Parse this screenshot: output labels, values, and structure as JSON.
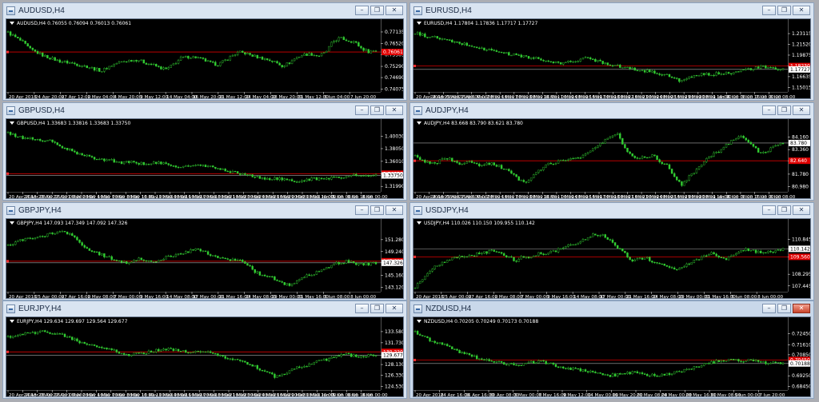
{
  "colors": {
    "candle": "#32cd32",
    "red_line": "#d70000",
    "ask_line": "#aaaaaa",
    "chart_bg": "#000000",
    "axis": "#ffffff"
  },
  "icons": {
    "window": "chart-window-icon",
    "minimize": "minimize-icon",
    "restore": "restore-icon",
    "close": "close-icon",
    "dropdown": "triangle-down-icon"
  },
  "window_buttons": {
    "minimize": "–",
    "restore": "❐",
    "close": "✕"
  },
  "windows": [
    {
      "title": "AUDUSD,H4",
      "header": "AUDUSD,H4  0.76055 0.76094 0.76013 0.76061",
      "price_labels": [
        "0.77135",
        "0.76520",
        "0.75905",
        "0.75290",
        "0.74690",
        "0.74075"
      ],
      "tags": [
        {
          "value": "0.76061",
          "style": "red"
        }
      ],
      "time_labels": [
        "20 Apr 2018",
        "24 Apr 20:00",
        "27 Apr 12:00",
        "2 May 04:00",
        "4 May 20:00",
        "9 May 12:00",
        "14 May 04:00",
        "16 May 20:00",
        "21 May 12:00",
        "24 May 04:00",
        "28 May 20:00",
        "31 May 12:00",
        "5 Jun 04:00",
        "7 Jun 20:00"
      ],
      "series": [
        0.771,
        0.7685,
        0.766,
        0.7622,
        0.7603,
        0.7585,
        0.7572,
        0.7558,
        0.7552,
        0.7545,
        0.7535,
        0.7528,
        0.7515,
        0.7505,
        0.7528,
        0.7545,
        0.7555,
        0.7562,
        0.7565,
        0.7548,
        0.7538,
        0.7522,
        0.7512,
        0.7542,
        0.7575,
        0.758,
        0.7578,
        0.7565,
        0.7548,
        0.7538,
        0.7558,
        0.7585,
        0.7605,
        0.7598,
        0.7585,
        0.7575,
        0.7565,
        0.7552,
        0.7532,
        0.7548,
        0.7578,
        0.7592,
        0.7595,
        0.7585,
        0.7602,
        0.766,
        0.7682,
        0.7668,
        0.7662,
        0.7625,
        0.7608,
        0.7615
      ],
      "min": 0.7405,
      "max": 0.7722,
      "red_level": 0.7606,
      "ask_level": null
    },
    {
      "title": "EURUSD,H4",
      "header": "EURUSD,H4  1.17804 1.17836 1.17717 1.17727",
      "price_labels": [
        "1.23115",
        "1.21520",
        "1.19875",
        "1.18230",
        "1.16635",
        "1.15015"
      ],
      "tags": [
        {
          "value": "1.18230",
          "style": "red"
        },
        {
          "value": "1.17727",
          "style": "white"
        }
      ],
      "time_labels": [
        "20 Apr 2018",
        "24 Apr 08:00",
        "25 Apr 16:00",
        "27 Apr 00:00",
        "1 May 08:00",
        "2 May 16:00",
        "4 May 00:00",
        "7 May 08:00",
        "8 May 16:00",
        "10 May 00:00",
        "11 May 08:00",
        "14 May 16:00",
        "16 May 00:00",
        "17 May 08:00",
        "18 May 16:00",
        "22 May 00:00",
        "23 May 08:00",
        "24 May 16:00",
        "28 May 00:00",
        "29 May 08:00",
        "30 May 16:00",
        "1 Jun 00:00",
        "4 Jun 08:00",
        "5 Jun 16:00",
        "7 Jun 00:00",
        "8 Jun 08:00"
      ],
      "series": [
        1.232,
        1.229,
        1.226,
        1.225,
        1.222,
        1.219,
        1.217,
        1.215,
        1.212,
        1.209,
        1.207,
        1.205,
        1.203,
        1.2,
        1.199,
        1.197,
        1.195,
        1.193,
        1.19,
        1.188,
        1.186,
        1.188,
        1.19,
        1.192,
        1.195,
        1.191,
        1.188,
        1.185,
        1.183,
        1.18,
        1.178,
        1.176,
        1.175,
        1.173,
        1.171,
        1.168,
        1.163,
        1.16,
        1.164,
        1.168,
        1.17,
        1.169,
        1.171,
        1.173,
        1.172,
        1.175,
        1.177,
        1.179,
        1.181,
        1.179,
        1.178,
        1.1773
      ],
      "min": 1.147,
      "max": 1.236,
      "red_level": 1.1825,
      "ask_level": 1.1773
    },
    {
      "title": "GBPUSD,H4",
      "header": "GBPUSD,H4  1.33683 1.33816 1.33683 1.33750",
      "price_labels": [
        "1.40030",
        "1.38050",
        "1.36010",
        "1.34030",
        "1.31990"
      ],
      "tags": [
        {
          "value": "1.34030",
          "style": "red"
        },
        {
          "value": "1.33750",
          "style": "white"
        }
      ],
      "time_labels": [
        "20 Apr 2018",
        "24 Apr 08:00",
        "25 Apr 16:00",
        "27 Apr 00:00",
        "1 May 08:00",
        "2 May 16:00",
        "4 May 00:00",
        "7 May 08:00",
        "8 May 16:00",
        "10 May 00:00",
        "11 May 08:00",
        "14 May 16:00",
        "16 May 00:00",
        "17 May 08:00",
        "18 May 16:00",
        "21 May 00:00",
        "23 May 08:00",
        "24 May 16:00",
        "28 May 00:00",
        "29 May 08:00",
        "31 May 16:00",
        "1 Jun 00:00",
        "5 Jun 08:00",
        "6 Jun 16:00",
        "8 Jun 00:00"
      ],
      "series": [
        1.405,
        1.401,
        1.398,
        1.397,
        1.395,
        1.394,
        1.392,
        1.386,
        1.38,
        1.376,
        1.371,
        1.368,
        1.365,
        1.364,
        1.362,
        1.36,
        1.358,
        1.359,
        1.357,
        1.356,
        1.358,
        1.357,
        1.355,
        1.353,
        1.351,
        1.352,
        1.354,
        1.353,
        1.351,
        1.349,
        1.346,
        1.343,
        1.341,
        1.339,
        1.336,
        1.333,
        1.332,
        1.333,
        1.331,
        1.329,
        1.327,
        1.33,
        1.332,
        1.331,
        1.333,
        1.334,
        1.335,
        1.336,
        1.338,
        1.336,
        1.337,
        1.3375
      ],
      "min": 1.315,
      "max": 1.41,
      "red_level": 1.3403,
      "ask_level": 1.3375
    },
    {
      "title": "AUDJPY,H4",
      "header": "AUDJPY,H4  83.668 83.790 83.621 83.780",
      "price_labels": [
        "84.160",
        "83.780",
        "83.360",
        "82.640",
        "81.780",
        "80.980"
      ],
      "tags": [
        {
          "value": "83.780",
          "style": "white"
        },
        {
          "value": "82.640",
          "style": "red"
        }
      ],
      "time_labels": [
        "20 Apr 2018",
        "24 Apr 08:00",
        "25 Apr 16:00",
        "27 Apr 00:00",
        "1 May 08:00",
        "2 May 16:00",
        "4 May 00:00",
        "7 May 08:00",
        "8 May 16:00",
        "10 May 00:00",
        "11 May 08:00",
        "14 May 16:00",
        "16 May 00:00",
        "17 May 08:00",
        "18 May 16:00",
        "21 May 00:00",
        "23 May 08:00",
        "24 May 16:00",
        "28 May 00:00",
        "29 May 08:00",
        "30 May 16:00",
        "1 Jun 00:00",
        "4 Jun 08:00",
        "5 Jun 16:00",
        "7 Jun 00:00",
        "8 Jun 08:00"
      ],
      "series": [
        82.9,
        82.6,
        82.55,
        82.5,
        82.8,
        82.7,
        82.4,
        82.5,
        82.6,
        82.35,
        82.5,
        82.4,
        82.2,
        82.0,
        81.6,
        81.2,
        81.5,
        81.9,
        82.4,
        82.5,
        82.6,
        82.7,
        82.8,
        82.9,
        83.2,
        83.5,
        83.8,
        84.2,
        84.4,
        83.5,
        83.0,
        82.8,
        82.9,
        83.0,
        82.6,
        82.3,
        81.6,
        81.1,
        81.6,
        82.1,
        82.6,
        83.0,
        83.2,
        83.6,
        84.0,
        84.3,
        83.9,
        83.5,
        83.1,
        83.3,
        83.6,
        83.78
      ],
      "min": 80.8,
      "max": 84.6,
      "red_level": 82.64,
      "ask_level": 83.78
    },
    {
      "title": "GBPJPY,H4",
      "header": "GBPJPY,H4  147.093 147.349 147.092 147.326",
      "price_labels": [
        "151.280",
        "149.240",
        "147.326",
        "145.160",
        "143.120"
      ],
      "tags": [
        {
          "value": "147.600",
          "style": "red"
        },
        {
          "value": "147.326",
          "style": "white"
        }
      ],
      "time_labels": [
        "20 Apr 2018",
        "25 Apr 00:00",
        "27 Apr 16:00",
        "2 May 08:00",
        "7 May 00:00",
        "9 May 16:00",
        "14 May 08:00",
        "17 May 00:00",
        "21 May 16:00",
        "24 May 08:00",
        "29 May 00:00",
        "31 May 16:00",
        "5 Jun 08:00",
        "8 Jun 00:00"
      ],
      "series": [
        150.3,
        150.8,
        151.2,
        151.4,
        151.7,
        151.9,
        152.3,
        152.6,
        152.4,
        151.8,
        150.6,
        149.8,
        149.2,
        148.7,
        148.2,
        147.8,
        147.3,
        147.6,
        148.0,
        147.8,
        147.5,
        147.9,
        148.3,
        148.6,
        148.9,
        149.3,
        149.6,
        149.2,
        148.7,
        148.2,
        147.9,
        147.7,
        148.1,
        147.2,
        146.0,
        145.4,
        145.0,
        144.6,
        143.8,
        143.6,
        144.2,
        144.9,
        145.3,
        145.8,
        146.3,
        146.9,
        147.4,
        147.6,
        147.2,
        147.0,
        147.1,
        147.326
      ],
      "min": 142.8,
      "max": 152.9,
      "red_level": 147.6,
      "ask_level": 147.326
    },
    {
      "title": "USDJPY,H4",
      "header": "USDJPY,H4  110.026 110.150 109.955 110.142",
      "price_labels": [
        "110.845",
        "110.142",
        "109.560",
        "108.295",
        "107.445"
      ],
      "tags": [
        {
          "value": "110.142",
          "style": "white"
        },
        {
          "value": "109.560",
          "style": "red"
        }
      ],
      "time_labels": [
        "20 Apr 2018",
        "25 Apr 00:00",
        "27 Apr 16:00",
        "2 May 08:00",
        "7 May 00:00",
        "9 May 16:00",
        "14 May 08:00",
        "17 May 00:00",
        "21 May 16:00",
        "24 May 08:00",
        "29 May 00:00",
        "31 May 16:00",
        "5 Jun 08:00",
        "8 Jun 00:00"
      ],
      "series": [
        107.4,
        107.9,
        108.5,
        108.9,
        109.2,
        109.4,
        109.5,
        109.6,
        109.7,
        109.8,
        109.9,
        110.0,
        109.7,
        109.5,
        109.3,
        109.6,
        109.5,
        109.8,
        109.7,
        109.9,
        110.1,
        110.3,
        110.5,
        110.7,
        111.0,
        111.2,
        111.1,
        110.8,
        110.3,
        109.8,
        109.3,
        109.4,
        109.5,
        109.2,
        109.0,
        108.9,
        108.7,
        108.8,
        109.1,
        109.3,
        109.6,
        109.8,
        109.5,
        109.4,
        109.6,
        109.9,
        110.1,
        110.0,
        109.8,
        109.9,
        110.0,
        110.142
      ],
      "min": 107.2,
      "max": 111.5,
      "red_level": 109.56,
      "ask_level": 110.142
    },
    {
      "title": "EURJPY,H4",
      "header": "EURJPY,H4  129.634 129.697 129.564 129.677",
      "price_labels": [
        "133.580",
        "131.730",
        "129.677",
        "128.130",
        "126.330",
        "124.530"
      ],
      "tags": [
        {
          "value": "130.220",
          "style": "red"
        },
        {
          "value": "129.677",
          "style": "white"
        }
      ],
      "time_labels": [
        "20 Apr 2018",
        "24 Apr 08:00",
        "25 Apr 16:00",
        "27 Apr 00:00",
        "1 May 08:00",
        "2 May 16:00",
        "4 May 00:00",
        "7 May 08:00",
        "8 May 16:00",
        "10 May 00:00",
        "11 May 08:00",
        "14 May 16:00",
        "16 May 00:00",
        "17 May 08:00",
        "18 May 16:00",
        "21 May 00:00",
        "23 May 08:00",
        "24 May 16:00",
        "28 May 00:00",
        "29 May 08:00",
        "31 May 16:00",
        "1 Jun 00:00",
        "5 Jun 08:00",
        "6 Jun 16:00",
        "8 Jun 00:00"
      ],
      "series": [
        132.7,
        132.9,
        133.1,
        133.3,
        133.5,
        133.6,
        133.4,
        133.1,
        132.8,
        132.4,
        131.9,
        131.5,
        131.2,
        130.9,
        130.6,
        130.3,
        130.0,
        129.7,
        129.9,
        130.1,
        130.3,
        130.5,
        130.7,
        130.5,
        130.3,
        130.1,
        130.3,
        130.5,
        130.2,
        129.8,
        129.4,
        129.0,
        128.7,
        128.3,
        127.9,
        127.3,
        126.7,
        126.1,
        126.5,
        127.0,
        127.5,
        127.9,
        128.2,
        128.6,
        128.9,
        129.3,
        129.6,
        129.8,
        129.5,
        129.4,
        129.6,
        129.677
      ],
      "min": 124.3,
      "max": 134.1,
      "red_level": 130.22,
      "ask_level": 129.677
    },
    {
      "title": "NZDUSD,H4",
      "header": "NZDUSD,H4  0.70205 0.70249 0.70173 0.70188",
      "price_labels": [
        "0.72450",
        "0.71610",
        "0.70850",
        "0.70188",
        "0.69250",
        "0.68450"
      ],
      "tags": [
        {
          "value": "0.70450",
          "style": "red"
        },
        {
          "value": "0.70188",
          "style": "white"
        }
      ],
      "time_labels": [
        "20 Apr 2018",
        "24 Apr 16:00",
        "26 Apr 16:00",
        "30 Apr 08:00",
        "3 May 00:00",
        "7 May 16:00",
        "9 May 12:00",
        "14 May 00:00",
        "16 May 20:00",
        "21 May 08:00",
        "24 May 00:00",
        "28 May 16:00",
        "31 May 08:00",
        "5 Jun 00:00",
        "7 Jun 20:00"
      ],
      "series": [
        0.7255,
        0.7225,
        0.72,
        0.718,
        0.716,
        0.7135,
        0.711,
        0.709,
        0.707,
        0.7055,
        0.7045,
        0.7035,
        0.7025,
        0.7015,
        0.7005,
        0.7015,
        0.7028,
        0.7035,
        0.7025,
        0.701,
        0.6995,
        0.6985,
        0.6975,
        0.6965,
        0.6958,
        0.6945,
        0.6935,
        0.6925,
        0.6935,
        0.6945,
        0.695,
        0.6942,
        0.6935,
        0.693,
        0.6925,
        0.6935,
        0.695,
        0.6965,
        0.698,
        0.6995,
        0.701,
        0.7025,
        0.7035,
        0.704,
        0.7045,
        0.7035,
        0.704,
        0.7045,
        0.703,
        0.7025,
        0.702,
        0.70188
      ],
      "min": 0.6835,
      "max": 0.7285,
      "red_level": 0.7045,
      "ask_level": 0.70188
    }
  ]
}
